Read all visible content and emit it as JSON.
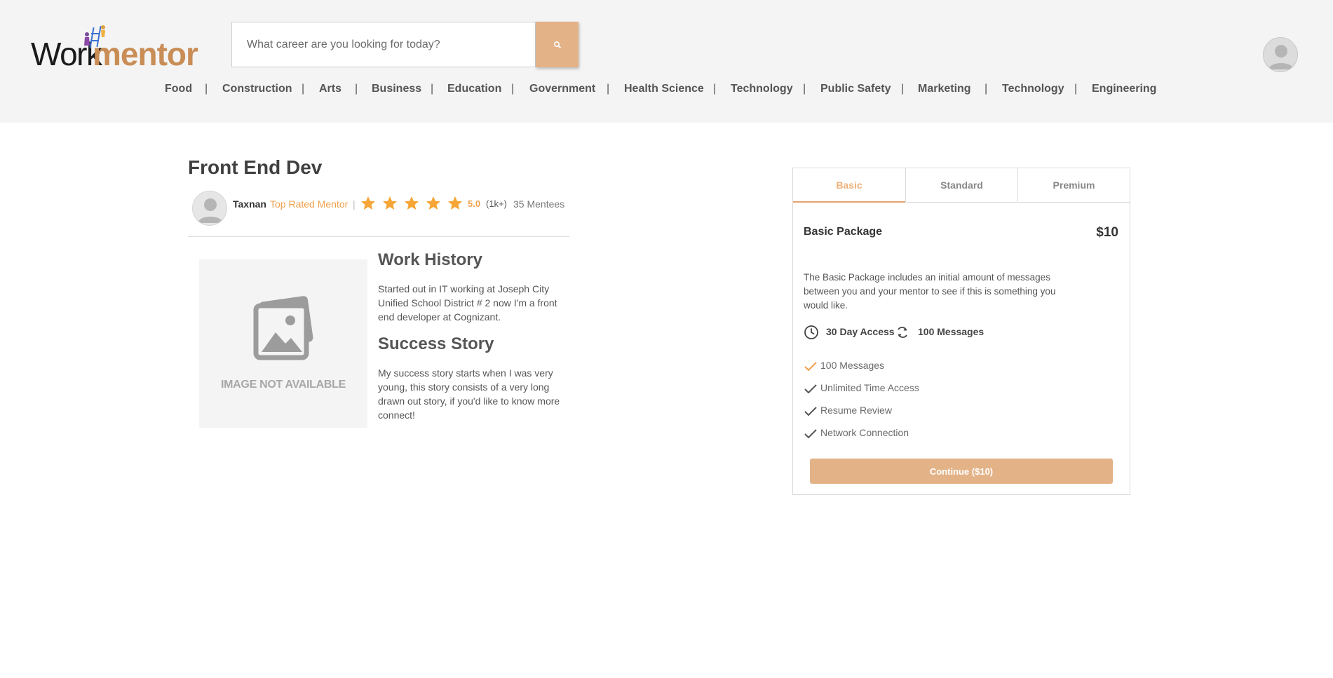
{
  "brand": {
    "name_part1": "Work",
    "name_part2": "mentor"
  },
  "search": {
    "placeholder": "What career are you looking for today?"
  },
  "nav": {
    "items": [
      "Food",
      "Construction",
      "Arts",
      "Business",
      "Education",
      "Government",
      "Health Science",
      "Technology",
      "Public Safety",
      "Marketing",
      "Technology",
      "Engineering"
    ],
    "separator": "|"
  },
  "gig": {
    "title": "Front End Dev",
    "mentor_name": "Taxnan",
    "mentor_badge": "Top Rated Mentor",
    "separator": "|",
    "rating": "5.0",
    "rating_count": "(1k+)",
    "mentees": "35 Mentees",
    "star_count": 5,
    "image_placeholder": "IMAGE NOT AVAILABLE",
    "work_history_title": "Work History",
    "work_history_text": "Started out in IT working at Joseph City Unified School District # 2 now I'm a front end developer at Cognizant.",
    "success_story_title": "Success Story",
    "success_story_text": "My success story starts when I was very young, this story consists of a very long drawn out story, if you'd like to know more connect!"
  },
  "package": {
    "tabs": [
      "Basic",
      "Standard",
      "Premium"
    ],
    "active_tab": "Basic",
    "name": "Basic Package",
    "price": "$10",
    "description": "The Basic Package includes an initial amount of messages between you and your mentor to see if this is something you would like.",
    "access": "30 Day Access",
    "messages": "100 Messages",
    "features": [
      "100 Messages",
      "Unlimited Time Access",
      "Resume Review",
      "Network Connection"
    ],
    "continue_label": "Continue ($10)"
  },
  "colors": {
    "accent": "#e3b287",
    "accent_text": "#f0a04b",
    "star": "#f5a637",
    "header_bg": "#f4f4f4"
  }
}
